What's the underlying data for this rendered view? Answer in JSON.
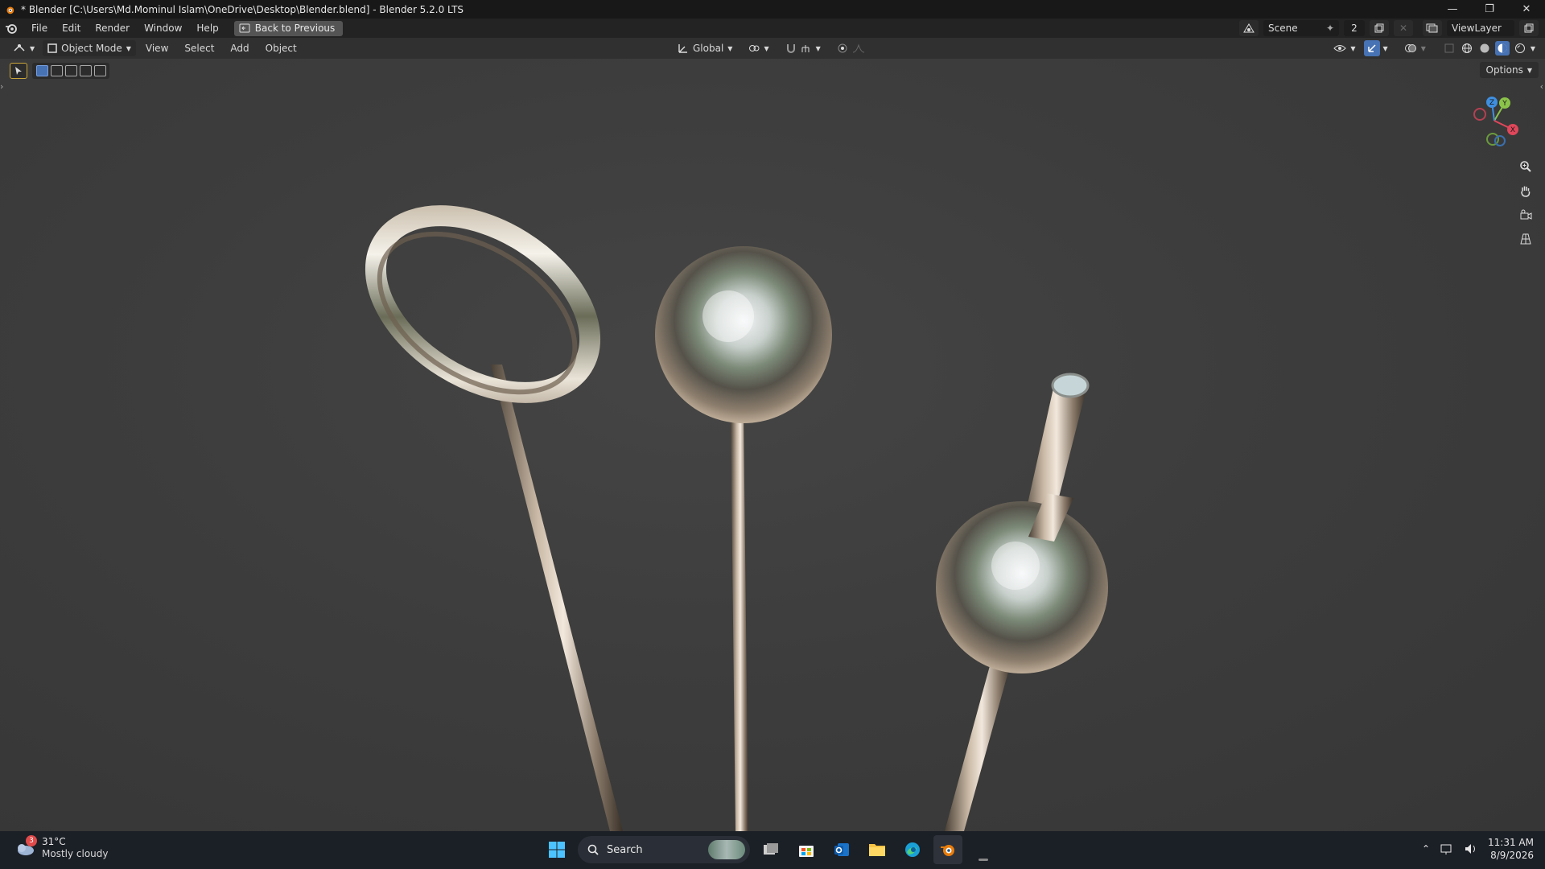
{
  "window": {
    "title": "* Blender [C:\\Users\\Md.Mominul Islam\\OneDrive\\Desktop\\Blender.blend] - Blender 5.2.0 LTS"
  },
  "menubar": {
    "items": [
      "File",
      "Edit",
      "Render",
      "Window",
      "Help"
    ],
    "back_button": "Back to Previous",
    "scene_name": "Scene",
    "scene_users": "2",
    "view_layer": "ViewLayer"
  },
  "viewport_header": {
    "mode": "Object Mode",
    "menus": [
      "View",
      "Select",
      "Add",
      "Object"
    ],
    "transform_orientation": "Global"
  },
  "viewport": {
    "options_label": "Options",
    "gizmo_axes": [
      "X",
      "Y",
      "Z"
    ]
  },
  "taskbar": {
    "weather_badge": "3",
    "temperature": "31°C",
    "condition": "Mostly cloudy",
    "search_placeholder": "Search",
    "time": "11:31 AM",
    "date": "8/9/2026"
  },
  "colors": {
    "accent": "#4772b3",
    "axis_x": "#e0475a",
    "axis_y": "#8bc34a",
    "axis_z": "#3f8fe0"
  }
}
